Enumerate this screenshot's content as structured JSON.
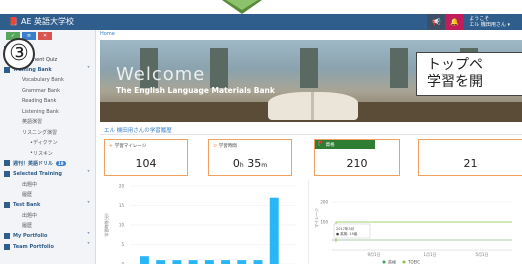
{
  "app": {
    "title": "AE 英語大学校",
    "user_greeting": "ようこそ",
    "user_name": "エル 機田用さん"
  },
  "breadcrumb": {
    "home": "Home"
  },
  "sidebar": {
    "buttons": [
      "✓",
      "≡",
      "✕"
    ],
    "items": [
      {
        "label": "Home",
        "kind": "head"
      },
      {
        "label": "Placement Quiz",
        "kind": "item"
      },
      {
        "label": "Training Bank",
        "kind": "head"
      },
      {
        "label": "Vocabulary Bank",
        "kind": "sub"
      },
      {
        "label": "Grammar Bank",
        "kind": "sub"
      },
      {
        "label": "Reading Bank",
        "kind": "sub"
      },
      {
        "label": "Listening Bank",
        "kind": "sub"
      },
      {
        "label": "英語演習",
        "kind": "sub"
      },
      {
        "label": "リスニング演習",
        "kind": "sub"
      },
      {
        "label": "ディクテン",
        "kind": "subsub"
      },
      {
        "label": "リスキン",
        "kind": "subsub"
      },
      {
        "label": "週刊！英語ドリル",
        "kind": "head",
        "badge": "19"
      },
      {
        "label": "Selected Training",
        "kind": "head"
      },
      {
        "label": "出題中",
        "kind": "sub"
      },
      {
        "label": "履歴",
        "kind": "sub"
      },
      {
        "label": "Test Bank",
        "kind": "head"
      },
      {
        "label": "出題中",
        "kind": "sub"
      },
      {
        "label": "履歴",
        "kind": "sub"
      },
      {
        "label": "My Portfolio",
        "kind": "head"
      },
      {
        "label": "Team Portfolio",
        "kind": "head"
      }
    ]
  },
  "hero": {
    "title": "Welcome",
    "subtitle": "The English Language Materials Bank"
  },
  "callout": {
    "line1": "トップペ",
    "line2": "学習を開"
  },
  "step_number": "③",
  "section": {
    "label": "エル 機田用さんの学習履歴"
  },
  "cards": [
    {
      "label": "学習マイレージ",
      "value": "104",
      "unit": "",
      "color": "#f08a3c"
    },
    {
      "label": "学習時間",
      "value": "0",
      "value2": "35",
      "unit1": "h",
      "unit2": "m",
      "color": "#f08a3c"
    },
    {
      "label": "資格",
      "value": "210",
      "unit": "",
      "color": "#2e7d32"
    },
    {
      "label": "",
      "value": "21",
      "unit": "",
      "color": "#f08a3c"
    }
  ],
  "chart_data": [
    {
      "type": "bar",
      "ylabel": "学習時間(分)",
      "yticks": [
        0,
        5,
        10,
        15,
        20
      ],
      "ylim": [
        0,
        20
      ],
      "values": [
        2,
        1,
        1,
        1,
        1,
        1,
        1,
        1,
        17
      ],
      "bar_color": "#29b6f6"
    },
    {
      "type": "line",
      "ylabel": "マイレージ",
      "yticks": [
        100,
        200
      ],
      "xlabels": [
        "9月1日",
        "1月1日",
        "5月1日"
      ],
      "tooltip_date": "2017年3月",
      "tooltip_text": "● 英検: 15級",
      "legend": [
        "英検",
        "TOEIC"
      ],
      "line_color": "#8bc34a"
    }
  ]
}
